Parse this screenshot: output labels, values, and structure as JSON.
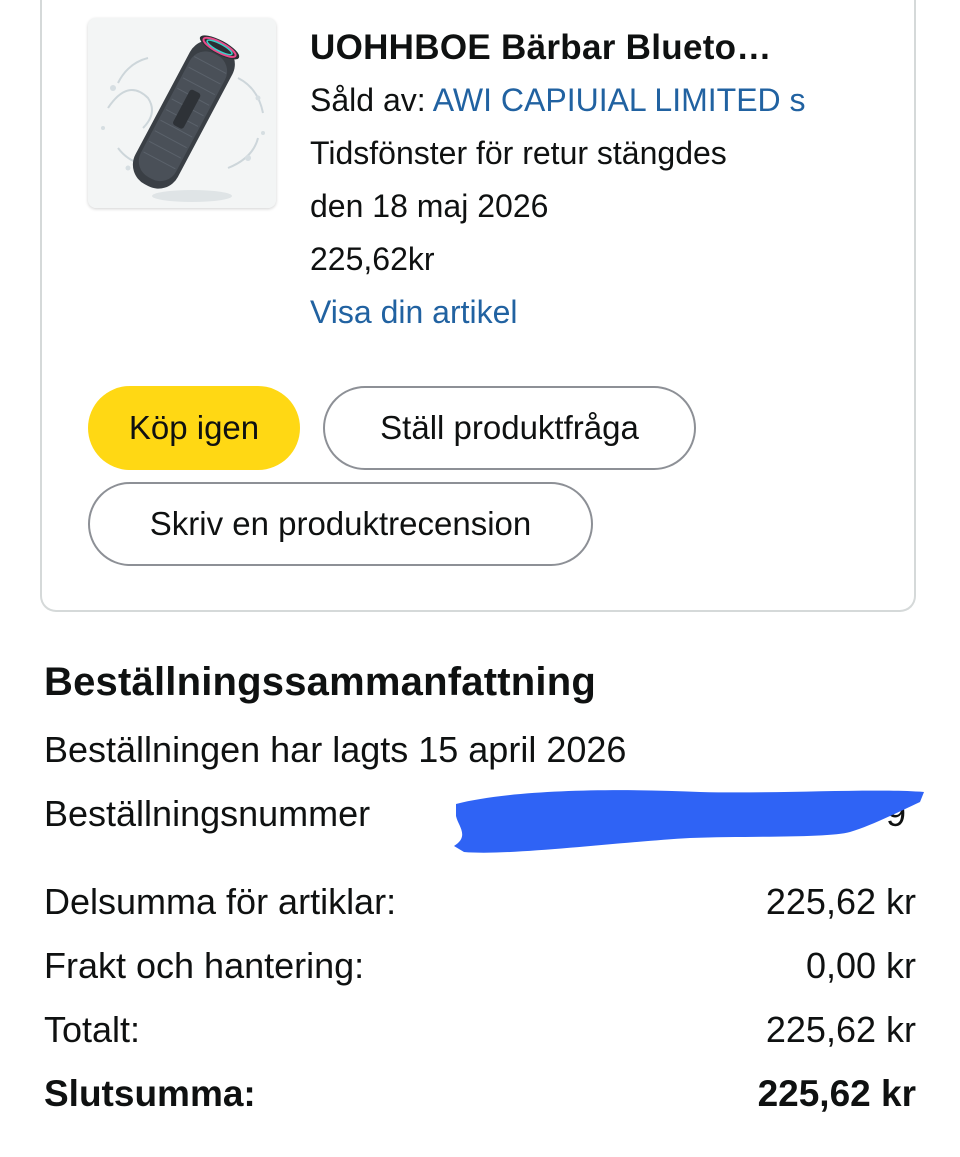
{
  "product": {
    "icon": "bluetooth-speaker-image",
    "title": "UOHHBOE Bärbar Blueto…",
    "sold_by_label": "Såld av: ",
    "seller": "AWI CAPIUIAL LIMITED s",
    "return_line1": "Tidsfönster för retur stängdes",
    "return_line2": "den 18 maj 2026",
    "price": "225,62kr",
    "view_link": "Visa din artikel"
  },
  "actions": {
    "buy_again": "Köp igen",
    "ask_question": "Ställ produktfråga",
    "write_review": "Skriv en produktrecension"
  },
  "summary": {
    "title": "Beställningssammanfattning",
    "order_placed": "Beställningen har lagts 15 april 2026",
    "order_number_label": "Beställningsnummer",
    "order_number_visible_tail": "9",
    "rows": [
      {
        "label": "Delsumma för artiklar:",
        "value": "225,62 kr"
      },
      {
        "label": "Frakt och hantering:",
        "value": "0,00 kr"
      },
      {
        "label": "Totalt:",
        "value": "225,62 kr"
      },
      {
        "label": "Slutsumma:",
        "value": "225,62 kr"
      }
    ]
  },
  "colors": {
    "accent_yellow": "#ffd814",
    "link_blue": "#2162a1",
    "redaction_blue": "#2f63f5"
  }
}
